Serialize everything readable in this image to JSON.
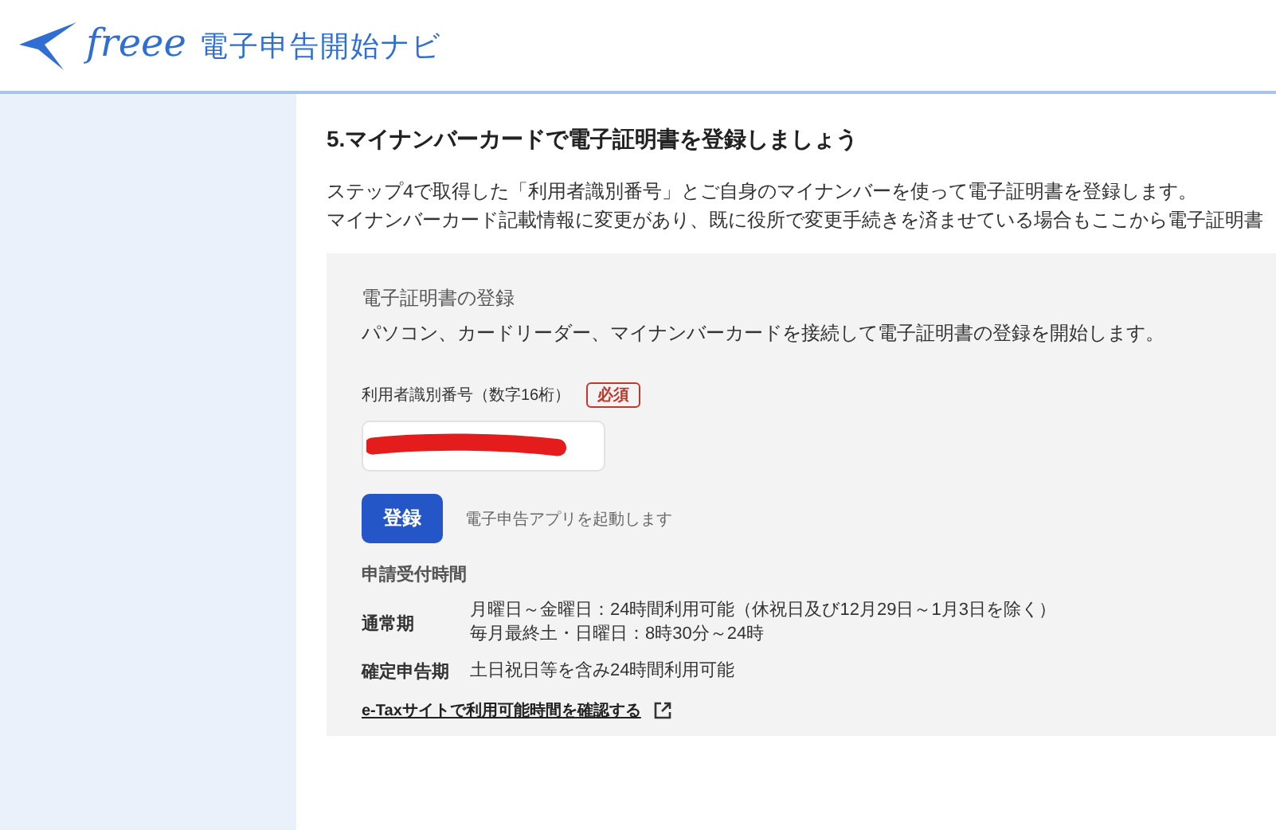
{
  "header": {
    "logo_text": "freee",
    "title": "電子申告開始ナビ"
  },
  "step": {
    "title": "5.マイナンバーカードで電子証明書を登録しましょう",
    "description": [
      "ステップ4で取得した「利用者識別番号」とご自身のマイナンバーを使って電子証明書を登録します。",
      "マイナンバーカード記載情報に変更があり、既に役所で変更手続きを済ませている場合もここから電子証明書"
    ]
  },
  "panel": {
    "heading": "電子証明書の登録",
    "text": "パソコン、カードリーダー、マイナンバーカードを接続して電子証明書の登録を開始します。",
    "field": {
      "label": "利用者識別番号（数字16桁）",
      "badge": "必須",
      "redacted": true
    },
    "button": "登録",
    "button_note": "電子申告アプリを起動します",
    "hours_heading": "申請受付時間",
    "hours": [
      {
        "term": "通常期",
        "lines": [
          "月曜日～金曜日：24時間利用可能（休祝日及び12月29日～1月3日を除く）",
          "毎月最終土・日曜日：8時30分～24時"
        ]
      },
      {
        "term": "確定申告期",
        "lines": [
          "土日祝日等を含み24時間利用可能"
        ]
      }
    ],
    "link": "e-Taxサイトで利用可能時間を確認する"
  }
}
